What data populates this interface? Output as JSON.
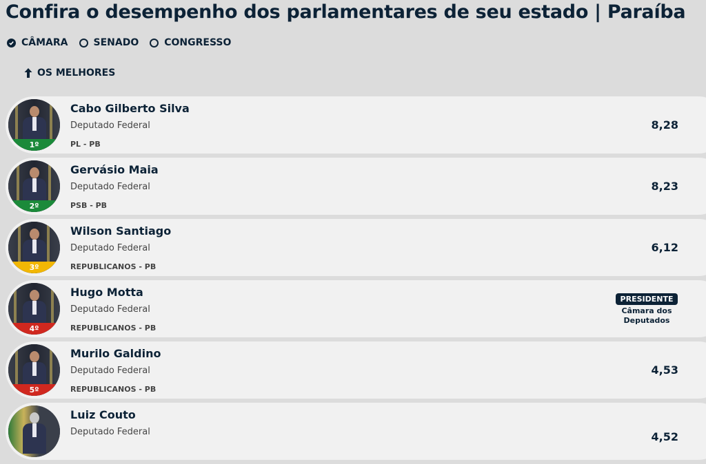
{
  "title": "Confira o desempenho dos parlamentares de seu estado | Paraíba",
  "tabs": [
    {
      "label": "CÂMARA",
      "checked": true
    },
    {
      "label": "SENADO",
      "checked": false
    },
    {
      "label": "CONGRESSO",
      "checked": false
    }
  ],
  "section_label": "OS MELHORES",
  "colors": {
    "green": "#1b8a3a",
    "yellow": "#f2b705",
    "red": "#d0281f",
    "navy": "#0c2236"
  },
  "rows": [
    {
      "rank": "1º",
      "name": "Cabo Gilberto Silva",
      "role": "Deputado Federal",
      "party": "PL - PB",
      "score": "8,28",
      "rank_color": "green"
    },
    {
      "rank": "2º",
      "name": "Gervásio Maia",
      "role": "Deputado Federal",
      "party": "PSB - PB",
      "score": "8,23",
      "rank_color": "green"
    },
    {
      "rank": "3º",
      "name": "Wilson Santiago",
      "role": "Deputado Federal",
      "party": "REPUBLICANOS - PB",
      "score": "6,12",
      "rank_color": "yellow"
    },
    {
      "rank": "4º",
      "name": "Hugo Motta",
      "role": "Deputado Federal",
      "party": "REPUBLICANOS - PB",
      "badge": "PRESIDENTE",
      "badge_sub_1": "Câmara dos",
      "badge_sub_2": "Deputados",
      "rank_color": "red"
    },
    {
      "rank": "5º",
      "name": "Murilo Galdino",
      "role": "Deputado Federal",
      "party": "REPUBLICANOS - PB",
      "score": "4,53",
      "rank_color": "red"
    },
    {
      "rank": "",
      "name": "Luiz Couto",
      "role": "Deputado Federal",
      "party": "",
      "score": "4,52",
      "rank_color": "red"
    }
  ]
}
